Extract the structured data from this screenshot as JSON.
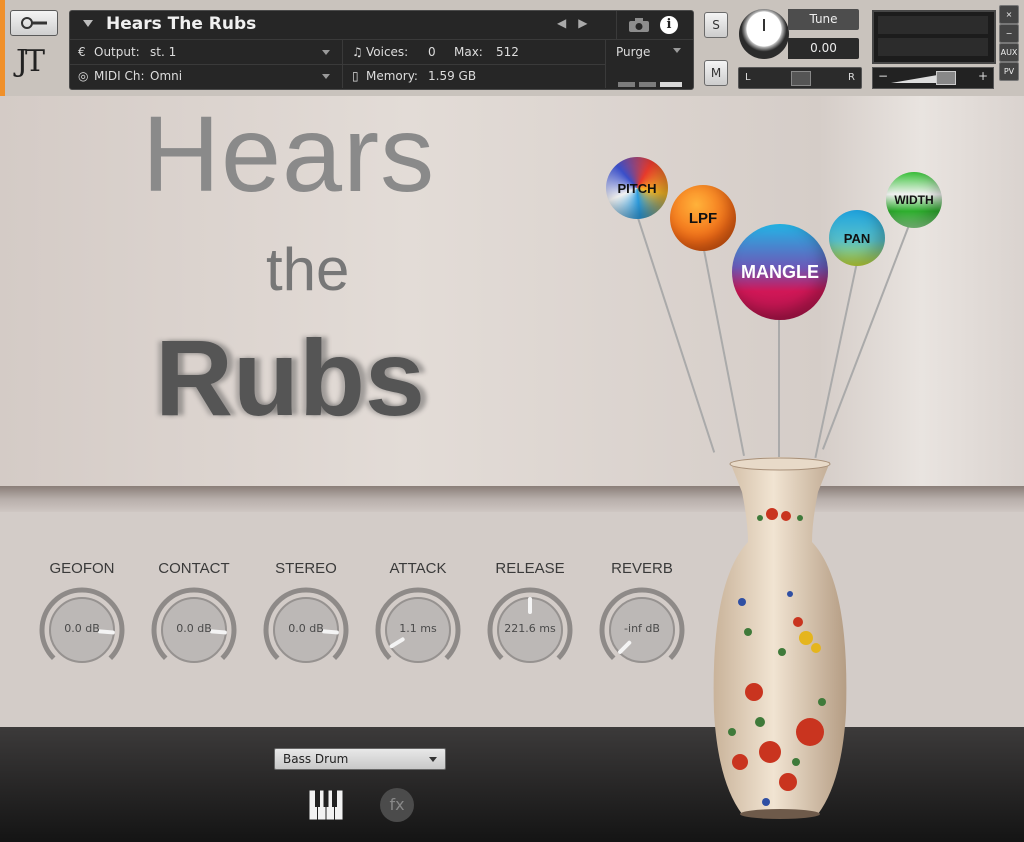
{
  "header": {
    "instrument_name": "Hears The Rubs",
    "output_label": "Output:",
    "output_value": "st. 1",
    "midi_label": "MIDI Ch:",
    "midi_value": "Omni",
    "voices_label": "Voices:",
    "voices_value": "0",
    "max_label": "Max:",
    "max_value": "512",
    "memory_label": "Memory:",
    "memory_value": "1.59 GB",
    "purge_label": "Purge",
    "solo_label": "S",
    "mute_label": "M",
    "tune_label": "Tune",
    "tune_value": "0.00",
    "pan_left": "L",
    "pan_right": "R",
    "vol_minus": "−",
    "vol_plus": "+",
    "aux_label": "AUX",
    "pv_label": "PV",
    "close_label": "×",
    "minimize_label": "−",
    "logo_text": "JT"
  },
  "title": {
    "line1": "Hears",
    "line2": "the",
    "line3": "Rubs"
  },
  "knobs": [
    {
      "label": "GEOFON",
      "value": "0.0 dB",
      "level": 0.85
    },
    {
      "label": "CONTACT",
      "value": "0.0 dB",
      "level": 0.85
    },
    {
      "label": "STEREO",
      "value": "0.0 dB",
      "level": 0.85
    },
    {
      "label": "ATTACK",
      "value": "1.1 ms",
      "level": 0.05
    },
    {
      "label": "RELEASE",
      "value": "221.6 ms",
      "level": 0.5
    },
    {
      "label": "REVERB",
      "value": "-inf dB",
      "level": 0.0
    }
  ],
  "balloons": [
    {
      "label": "PITCH"
    },
    {
      "label": "LPF"
    },
    {
      "label": "MANGLE"
    },
    {
      "label": "PAN"
    },
    {
      "label": "WIDTH"
    }
  ],
  "preset": {
    "value": "Bass Drum"
  },
  "footer": {
    "fx_label": "fx"
  },
  "colors": {
    "accent": "#f0902a",
    "header_bg": "#262626",
    "table": "#1f1d1d"
  }
}
